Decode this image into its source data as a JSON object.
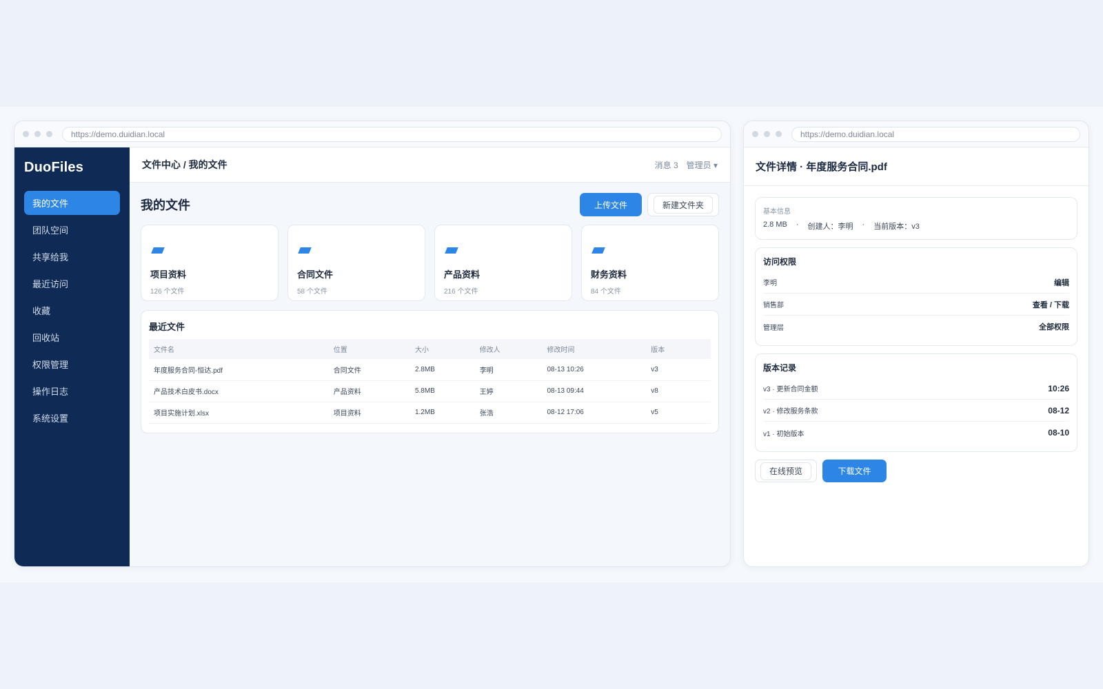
{
  "main_window": {
    "url": "https://demo.duidian.local",
    "brand": "DuoFiles",
    "nav": [
      {
        "label": "我的文件",
        "active": true
      },
      {
        "label": "团队空间",
        "active": false
      },
      {
        "label": "共享给我",
        "active": false
      },
      {
        "label": "最近访问",
        "active": false
      },
      {
        "label": "收藏",
        "active": false
      },
      {
        "label": "回收站",
        "active": false
      },
      {
        "label": "权限管理",
        "active": false
      },
      {
        "label": "操作日志",
        "active": false
      },
      {
        "label": "系统设置",
        "active": false
      }
    ],
    "breadcrumb": "文件中心 / 我的文件",
    "messages_label": "消息 3",
    "user_label": "管理员 ▾",
    "page_title": "我的文件",
    "upload_label": "上传文件",
    "new_folder_label": "新建文件夹",
    "folders": [
      {
        "name": "项目资料",
        "count": "126 个文件"
      },
      {
        "name": "合同文件",
        "count": "58 个文件"
      },
      {
        "name": "产品资料",
        "count": "216 个文件"
      },
      {
        "name": "财务资料",
        "count": "84 个文件"
      }
    ],
    "recent": {
      "title": "最近文件",
      "headers": [
        "文件名",
        "位置",
        "大小",
        "修改人",
        "修改时间",
        "版本"
      ],
      "rows": [
        [
          "年度服务合同-恒达.pdf",
          "合同文件",
          "2.8MB",
          "李明",
          "08-13 10:26",
          "v3"
        ],
        [
          "产品技术白皮书.docx",
          "产品资料",
          "5.8MB",
          "王婷",
          "08-13 09:44",
          "v8"
        ],
        [
          "项目实施计划.xlsx",
          "项目资料",
          "1.2MB",
          "张浩",
          "08-12 17:06",
          "v5"
        ]
      ]
    }
  },
  "detail_window": {
    "url": "https://demo.duidian.local",
    "title": "文件详情 · 年度服务合同.pdf",
    "basic": {
      "label": "基本信息",
      "size": "2.8 MB",
      "sep": "·",
      "creator": "创建人：李明",
      "version": "当前版本：v3"
    },
    "access": {
      "title": "访问权限",
      "rows": [
        {
          "key": "李明",
          "value": "编辑"
        },
        {
          "key": "销售部",
          "value": "查看 / 下载"
        },
        {
          "key": "管理层",
          "value": "全部权限"
        }
      ]
    },
    "versions": {
      "title": "版本记录",
      "rows": [
        {
          "key": "v3 · 更新合同金额",
          "value": "10:26"
        },
        {
          "key": "v2 · 修改服务条款",
          "value": "08-12"
        },
        {
          "key": "v1 · 初始版本",
          "value": "08-10"
        }
      ]
    },
    "preview_label": "在线预览",
    "download_label": "下载文件"
  },
  "colors": {
    "sidebar": "#0f2b55",
    "accent": "#2d86e6",
    "background": "#f4f7fb"
  },
  "icons": {
    "folder": "folder-icon",
    "window_dots": "window-control-dots"
  }
}
